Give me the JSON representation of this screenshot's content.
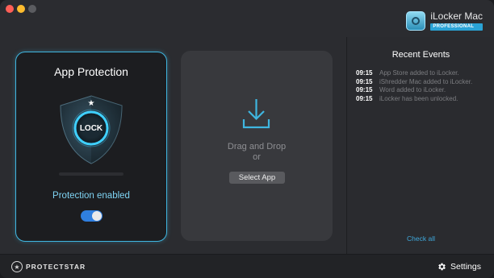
{
  "brand": {
    "name": "iLocker Mac",
    "edition": "PROFESSIONAL"
  },
  "protection": {
    "title": "App Protection",
    "lock_label": "LOCK",
    "status": "Protection enabled",
    "enabled": true
  },
  "drop": {
    "line1": "Drag and Drop",
    "line2": "or",
    "button": "Select App"
  },
  "events": {
    "title": "Recent Events",
    "items": [
      {
        "time": "09:15",
        "message": "App Store added to iLocker."
      },
      {
        "time": "09:15",
        "message": "iShredder Mac added to iLocker."
      },
      {
        "time": "09:15",
        "message": "Word added to iLocker."
      },
      {
        "time": "09:15",
        "message": "iLocker has been unlocked."
      }
    ],
    "check_all": "Check all"
  },
  "footer": {
    "company": "PROTECTSTAR",
    "settings": "Settings"
  },
  "colors": {
    "accent": "#3fb6e0",
    "toggle": "#2f7fe0",
    "link": "#3fa9dc"
  }
}
